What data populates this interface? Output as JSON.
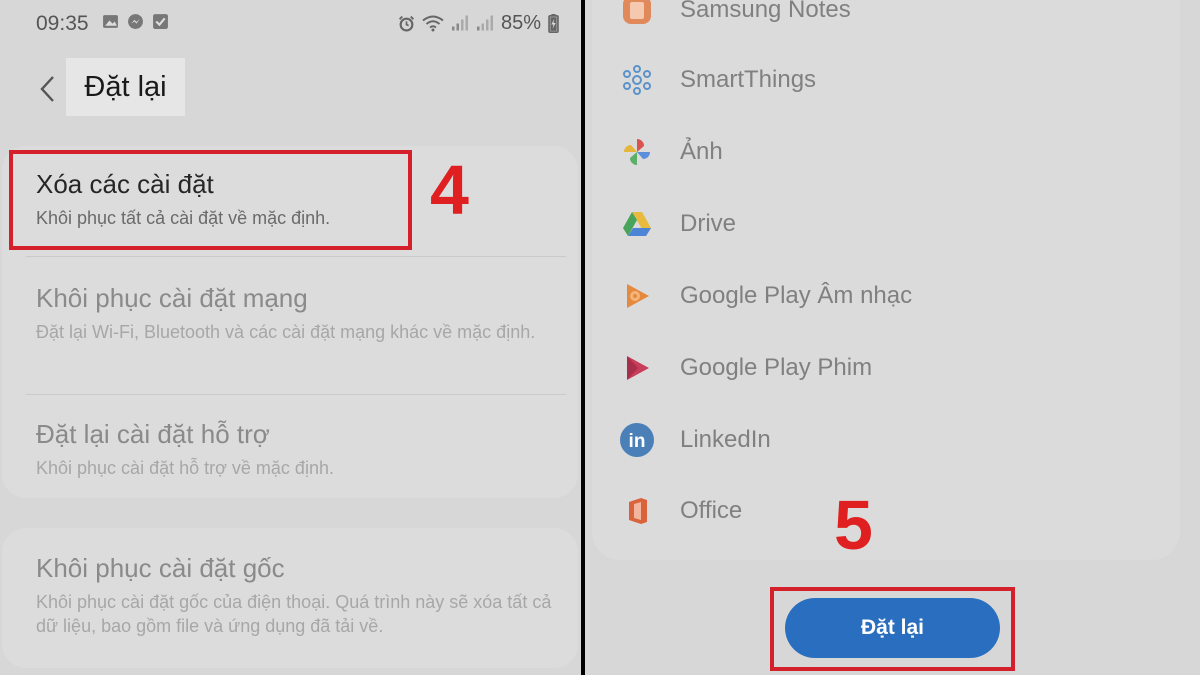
{
  "status_bar": {
    "time": "09:35",
    "battery": "85%"
  },
  "header": {
    "title": "Đặt lại"
  },
  "reset_options": [
    {
      "title": "Xóa các cài đặt",
      "description": "Khôi phục tất cả cài đặt về mặc định."
    },
    {
      "title": "Khôi phục cài đặt mạng",
      "description": "Đặt lại Wi-Fi, Bluetooth và các cài đặt mạng khác về mặc định."
    },
    {
      "title": "Đặt lại cài đặt hỗ trợ",
      "description": "Khôi phục cài đặt hỗ trợ về mặc định."
    },
    {
      "title": "Khôi phục cài đặt gốc",
      "description": "Khôi phục cài đặt gốc của điện thoại. Quá trình này sẽ xóa tất cả dữ liệu, bao gồm file và ứng dụng đã tải về."
    }
  ],
  "apps": [
    {
      "name": "Samsung Notes",
      "icon": "samsung-notes-icon"
    },
    {
      "name": "SmartThings",
      "icon": "smartthings-icon"
    },
    {
      "name": "Ảnh",
      "icon": "google-photos-icon"
    },
    {
      "name": "Drive",
      "icon": "google-drive-icon"
    },
    {
      "name": "Google Play Âm nhạc",
      "icon": "google-play-music-icon"
    },
    {
      "name": "Google Play Phim",
      "icon": "google-play-movies-icon"
    },
    {
      "name": "LinkedIn",
      "icon": "linkedin-icon"
    },
    {
      "name": "Office",
      "icon": "office-icon"
    }
  ],
  "reset_button": {
    "label": "Đặt lại"
  },
  "annotations": {
    "step_left": "4",
    "step_right": "5"
  },
  "colors": {
    "highlight": "#d3202a",
    "step_number": "#e02020",
    "reset_button": "#2a6fbf"
  }
}
